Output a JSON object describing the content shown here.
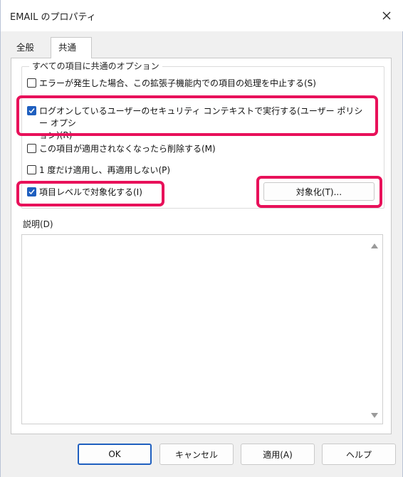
{
  "window": {
    "title": "EMAIL のプロパティ"
  },
  "tabs": [
    {
      "label": "全般",
      "active": false
    },
    {
      "label": "共通",
      "active": true
    }
  ],
  "group": {
    "legend": "すべての項目に共通のオプション"
  },
  "options": [
    {
      "label": "エラーが発生した場合、この拡張子機能内での項目の処理を中止する(S)",
      "checked": false
    },
    {
      "label": "ログオンしているユーザーのセキュリティ コンテキストで実行する(ユーザー ポリシー オプション)(R)",
      "label_line1": "ログオンしているユーザーのセキュリティ コンテキストで実行する(ユーザー ポリシー オプシ",
      "label_line2": "ョン)(R)",
      "checked": true
    },
    {
      "label": "この項目が適用されなくなったら削除する(M)",
      "checked": false
    },
    {
      "label": "1 度だけ適用し、再適用しない(P)",
      "checked": false
    },
    {
      "label": "項目レベルで対象化する(I)",
      "checked": true
    }
  ],
  "targeting_button": {
    "label": "対象化(T)..."
  },
  "description": {
    "label": "説明(D)",
    "value": ""
  },
  "footer": {
    "ok": "OK",
    "cancel": "キャンセル",
    "apply": "適用(A)",
    "help": "ヘルプ"
  },
  "colors": {
    "highlight": "#e8115a",
    "accent": "#1f5fbf"
  }
}
